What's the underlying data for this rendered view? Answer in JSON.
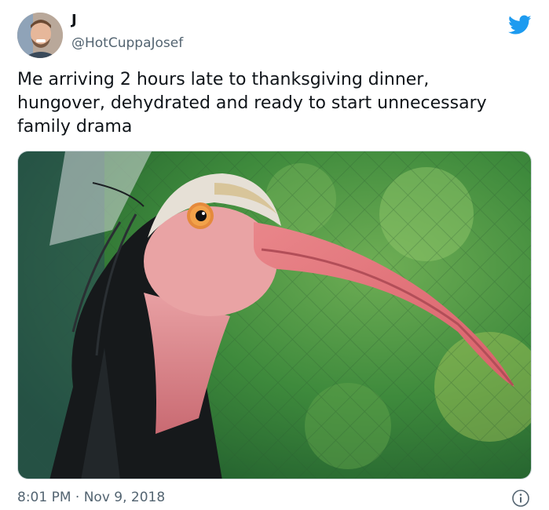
{
  "tweet": {
    "author_name": "J",
    "author_handle": "@HotCuppaJosef",
    "text": "Me arriving 2 hours late to thanksgiving dinner, hungover, dehydrated and ready to start unnecessary family drama",
    "timestamp": "8:01 PM · Nov 9, 2018"
  },
  "media": {
    "subject": "bald ibis close-up",
    "colors": {
      "background_green": "#3f8a3a",
      "skin_pink": "#e59a9a",
      "beak": "#e0757a",
      "feathers": "#1c1f22"
    }
  },
  "icons": {
    "logo": "twitter-bird-icon",
    "info": "info-icon"
  },
  "colors": {
    "brand": "#1d9bf0",
    "secondary_text": "#536471",
    "primary_text": "#0f1419"
  }
}
